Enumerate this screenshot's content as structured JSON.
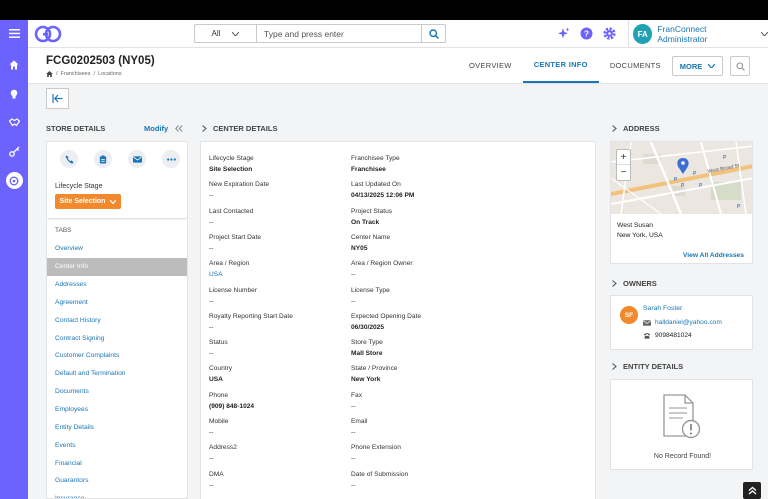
{
  "header": {
    "search_scope": "All",
    "search_placeholder": "Type and press enter",
    "user_initials": "FA",
    "user_name": "FranConnect Administrator"
  },
  "page": {
    "title": "FCG0202503 (NY05)",
    "breadcrumb": [
      "Franchisees",
      "Locations"
    ],
    "tabs": [
      {
        "label": "OVERVIEW",
        "active": false
      },
      {
        "label": "CENTER INFO",
        "active": true
      },
      {
        "label": "DOCUMENTS",
        "active": false
      }
    ],
    "more_label": "MORE"
  },
  "store_details": {
    "heading": "STORE DETAILS",
    "modify_label": "Modify",
    "lifecycle_label": "Lifecycle Stage",
    "lifecycle_value": "Site Selection",
    "tabs_label": "TABS",
    "tabs": [
      "Overview",
      "Center Info",
      "Addresses",
      "Agreement",
      "Contact History",
      "Contract Signing",
      "Customer Complaints",
      "Default and Termination",
      "Documents",
      "Employees",
      "Entity Details",
      "Events",
      "Financial",
      "Guarantors",
      "Insurance"
    ],
    "selected_tab": "Center Info"
  },
  "center_details": {
    "heading": "CENTER DETAILS",
    "fields": [
      {
        "label": "Lifecycle Stage",
        "value": "Site Selection",
        "style": "bold"
      },
      {
        "label": "Franchisee Type",
        "value": "Franchisee",
        "style": "bold"
      },
      {
        "label": "New Expiration Date",
        "value": "--",
        "style": "normal"
      },
      {
        "label": "Last Updated On",
        "value": "04/13/2025 12:06 PM",
        "style": "bold"
      },
      {
        "label": "Last Contacted",
        "value": "--",
        "style": "normal"
      },
      {
        "label": "Project Status",
        "value": "On Track",
        "style": "bold"
      },
      {
        "label": "Project Start Date",
        "value": "--",
        "style": "normal"
      },
      {
        "label": "Center Name",
        "value": "NY05",
        "style": "bold"
      },
      {
        "label": "Area / Region",
        "value": "USA",
        "style": "link"
      },
      {
        "label": "Area / Region Owner",
        "value": "--",
        "style": "normal"
      },
      {
        "label": "License Number",
        "value": "--",
        "style": "normal"
      },
      {
        "label": "License Type",
        "value": "--",
        "style": "normal"
      },
      {
        "label": "Royalty Reporting Start Date",
        "value": "--",
        "style": "normal"
      },
      {
        "label": "Expected Opening Date",
        "value": "06/30/2025",
        "style": "bold"
      },
      {
        "label": "Status",
        "value": "--",
        "style": "normal"
      },
      {
        "label": "Store Type",
        "value": "Mall Store",
        "style": "bold"
      },
      {
        "label": "Country",
        "value": "USA",
        "style": "bold"
      },
      {
        "label": "State / Province",
        "value": "New York",
        "style": "bold"
      },
      {
        "label": "Phone",
        "value": "(909) 848-1024",
        "style": "bold"
      },
      {
        "label": "Fax",
        "value": "--",
        "style": "normal"
      },
      {
        "label": "Mobile",
        "value": "--",
        "style": "normal"
      },
      {
        "label": "Email",
        "value": "--",
        "style": "normal"
      },
      {
        "label": "Address2",
        "value": "--",
        "style": "normal"
      },
      {
        "label": "Phone Extension",
        "value": "--",
        "style": "normal"
      },
      {
        "label": "DMA",
        "value": "--",
        "style": "normal"
      },
      {
        "label": "Date of Submission",
        "value": "--",
        "style": "normal"
      }
    ]
  },
  "address": {
    "heading": "ADDRESS",
    "map_street_label": "West Broad St",
    "line1": "West Susan",
    "line2": "New York, USA",
    "view_all_label": "View All Addresses"
  },
  "owners": {
    "heading": "OWNERS",
    "initials": "SF",
    "name": "Sarah Foster",
    "email": "halldaniel@yahoo.com",
    "phone": "9098481024"
  },
  "entity_details": {
    "heading": "ENTITY DETAILS",
    "empty_text": "No Record Found!"
  },
  "colors": {
    "accent": "#6c63ff",
    "link": "#1976b6",
    "lifecycle_badge": "#f28a2d"
  }
}
